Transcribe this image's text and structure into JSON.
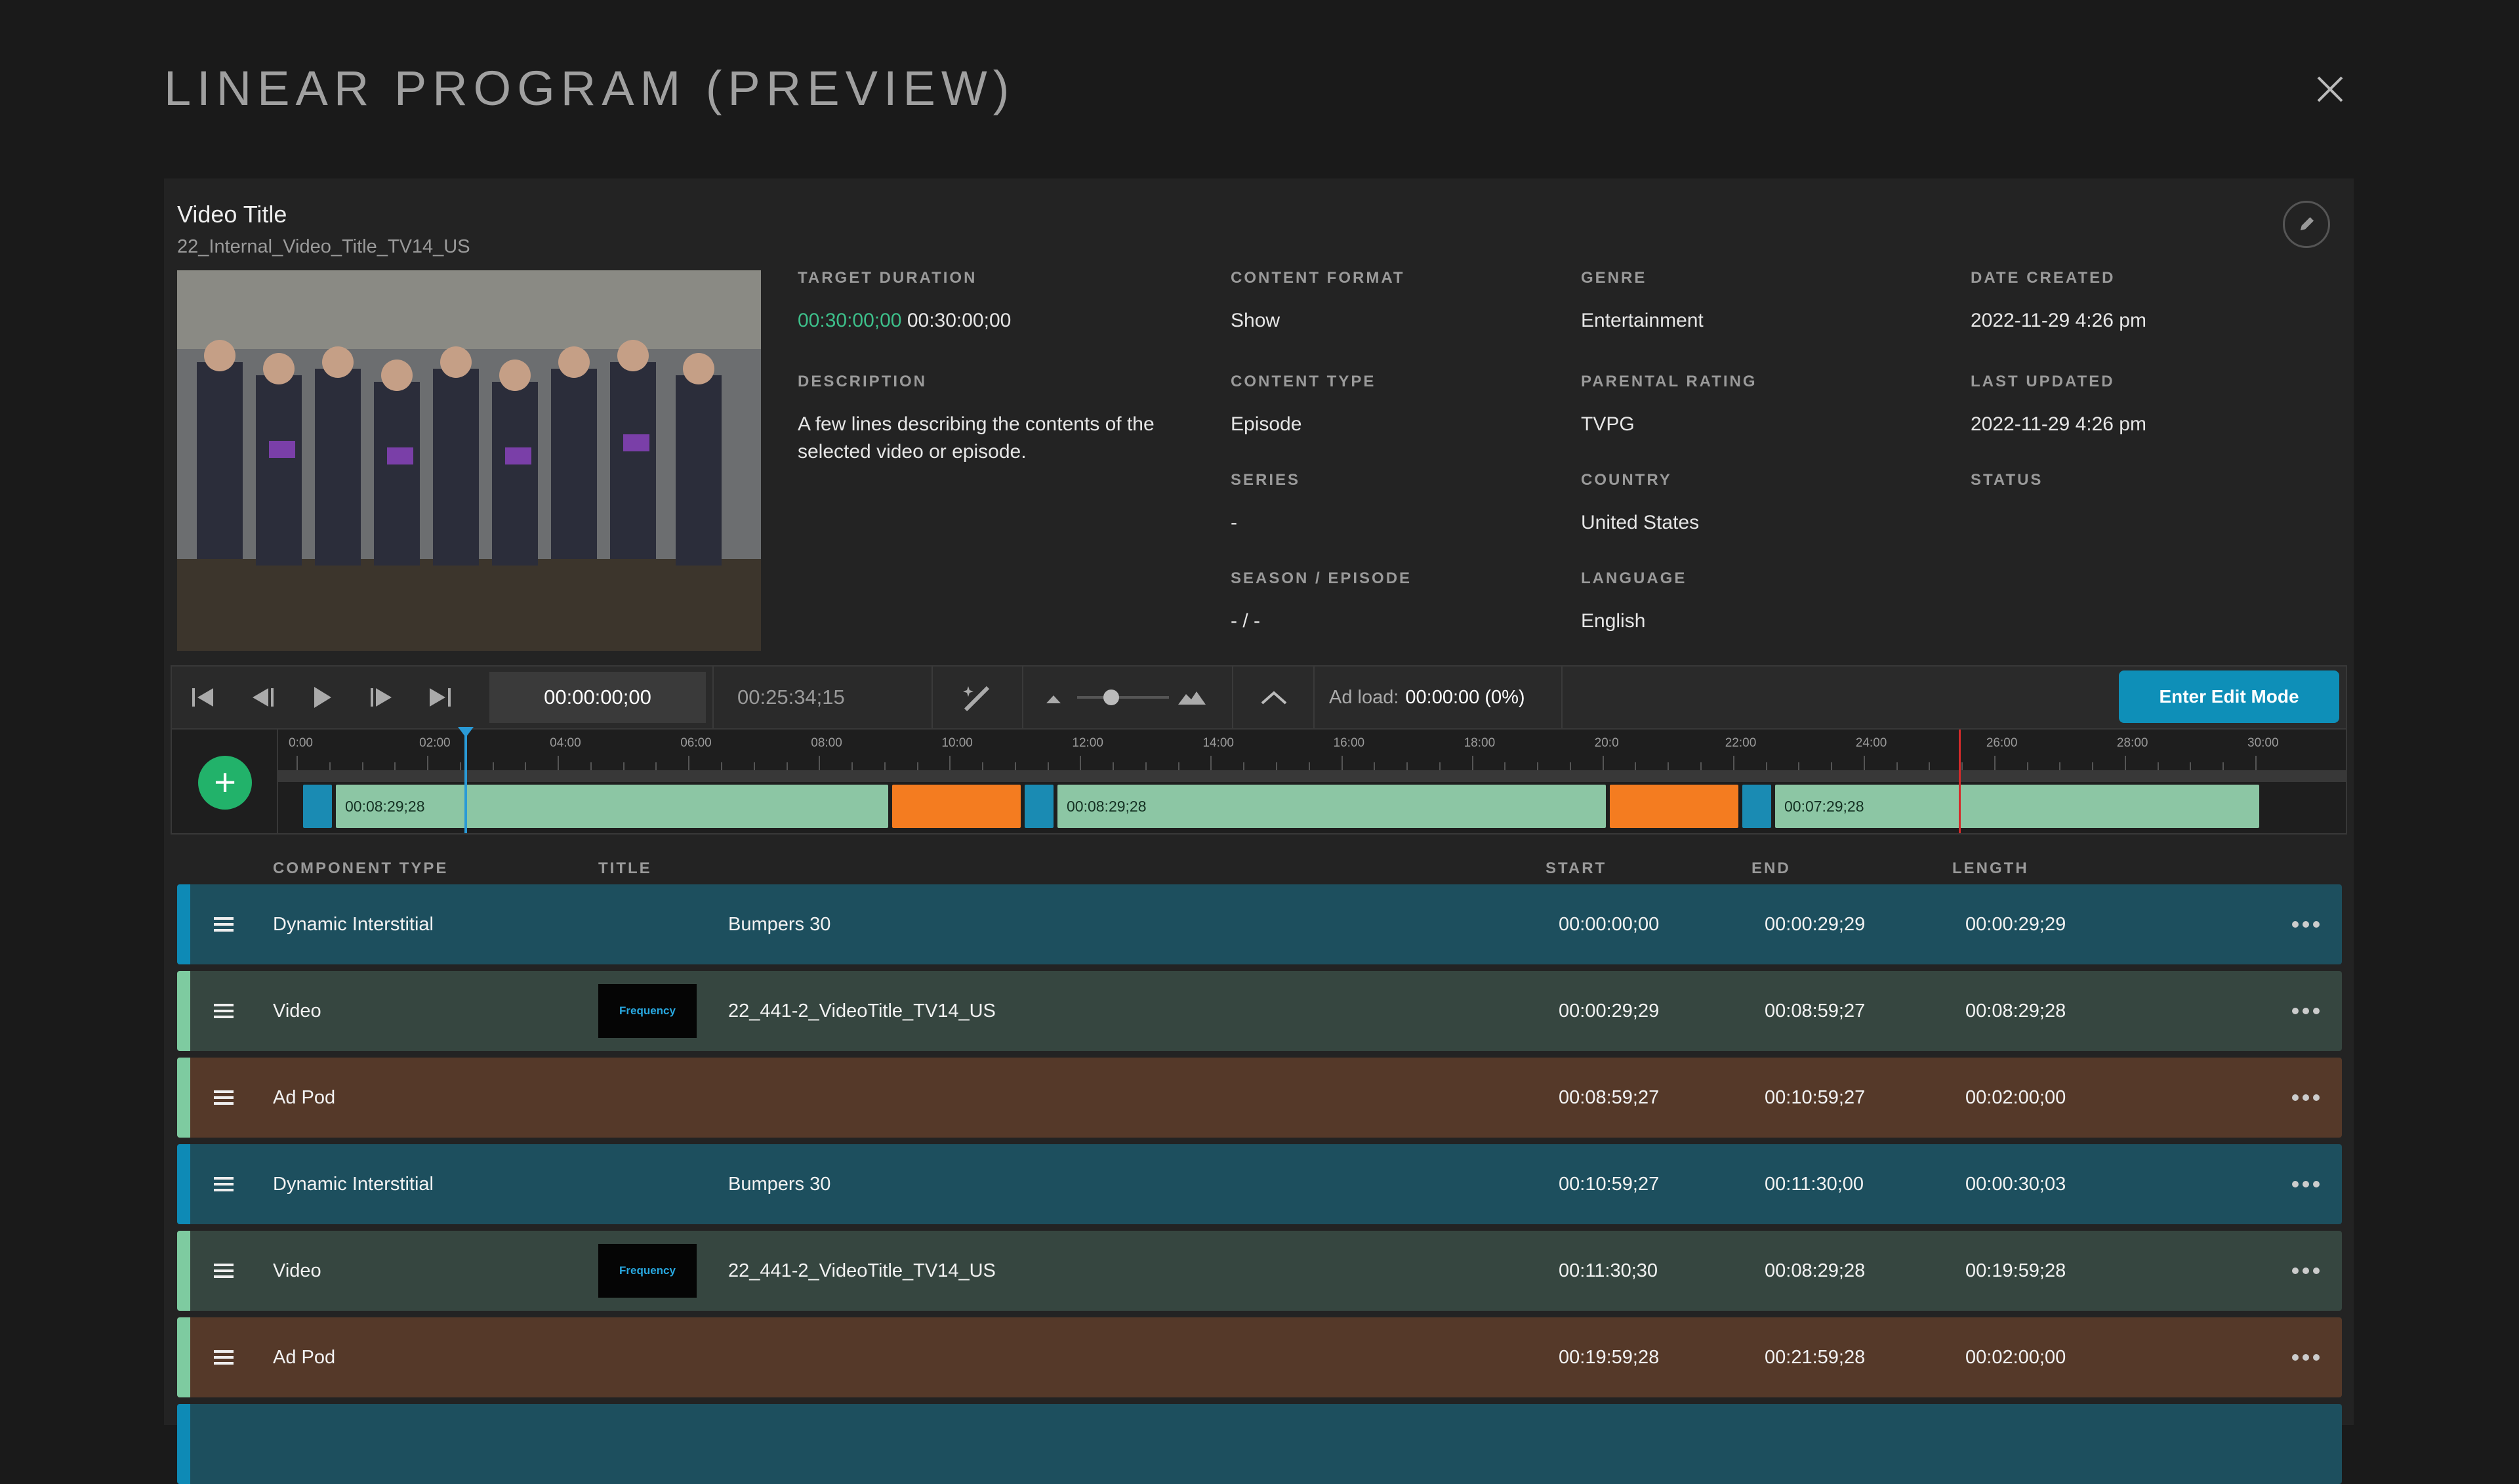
{
  "modal": {
    "title": "LINEAR PROGRAM (PREVIEW)"
  },
  "video": {
    "title": "Video Title",
    "subtitle": "22_Internal_Video_Title_TV14_US"
  },
  "details": {
    "target_duration": {
      "label": "TARGET DURATION",
      "value_current": "00:30:00;00",
      "value_total": "00:30:00;00"
    },
    "description": {
      "label": "DESCRIPTION",
      "value": "A few lines describing the contents of the selected video or episode."
    },
    "content_format": {
      "label": "CONTENT FORMAT",
      "value": "Show"
    },
    "content_type": {
      "label": "CONTENT TYPE",
      "value": "Episode"
    },
    "series": {
      "label": "SERIES",
      "value": "-"
    },
    "season_episode": {
      "label": "SEASON / EPISODE",
      "value": "- / -"
    },
    "genre": {
      "label": "GENRE",
      "value": "Entertainment"
    },
    "parental_rating": {
      "label": "PARENTAL RATING",
      "value": "TVPG"
    },
    "country": {
      "label": "COUNTRY",
      "value": "United States"
    },
    "language": {
      "label": "LANGUAGE",
      "value": "English"
    },
    "date_created": {
      "label": "DATE CREATED",
      "value": "2022-11-29 4:26 pm"
    },
    "last_updated": {
      "label": "LAST UPDATED",
      "value": "2022-11-29 4:26 pm"
    },
    "status": {
      "label": "STATUS",
      "value": ""
    }
  },
  "toolbar": {
    "timecode": "00:00:00;00",
    "duration": "00:25:34;15",
    "ad_load_label": "Ad load:",
    "ad_load_value": "00:00:00 (0%)",
    "enter_edit": "Enter Edit Mode"
  },
  "timeline": {
    "add": "+",
    "ticks": [
      "0:00",
      "02:00",
      "04:00",
      "06:00",
      "08:00",
      "10:00",
      "12:00",
      "14:00",
      "16:00",
      "18:00",
      "20:0",
      "22:00",
      "24:00",
      "26:00",
      "28:00",
      "30:00"
    ],
    "segment_labels": [
      "00:08:29;28",
      "00:08:29;28",
      "00:07:29;28"
    ]
  },
  "table": {
    "headers": {
      "type": "COMPONENT TYPE",
      "title": "TITLE",
      "start": "START",
      "end": "END",
      "length": "LENGTH"
    },
    "logo_text": "Frequency",
    "more": "•••",
    "rows": [
      {
        "type": "Dynamic Interstitial",
        "title": "Bumpers 30",
        "start": "00:00:00;00",
        "end": "00:00:29;29",
        "length": "00:00:29;29"
      },
      {
        "type": "Video",
        "title": "22_441-2_VideoTitle_TV14_US",
        "start": "00:00:29;29",
        "end": "00:08:59;27",
        "length": "00:08:29;28"
      },
      {
        "type": "Ad Pod",
        "title": "",
        "start": "00:08:59;27",
        "end": "00:10:59;27",
        "length": "00:02:00;00"
      },
      {
        "type": "Dynamic Interstitial",
        "title": "Bumpers 30",
        "start": "00:10:59;27",
        "end": "00:11:30;00",
        "length": "00:00:30;03"
      },
      {
        "type": "Video",
        "title": "22_441-2_VideoTitle_TV14_US",
        "start": "00:11:30;30",
        "end": "00:08:29;28",
        "length": "00:19:59;28"
      },
      {
        "type": "Ad Pod",
        "title": "",
        "start": "00:19:59;28",
        "end": "00:21:59;28",
        "length": "00:02:00;00"
      }
    ]
  },
  "colors": {
    "accent": "#0e8fb8",
    "interstitial": "#1d4f5e",
    "video": "#364640",
    "ad_pod": "#553929",
    "green": "#22b26a",
    "playhead": "#2a9ad6",
    "endmarker": "#d42a2a"
  }
}
